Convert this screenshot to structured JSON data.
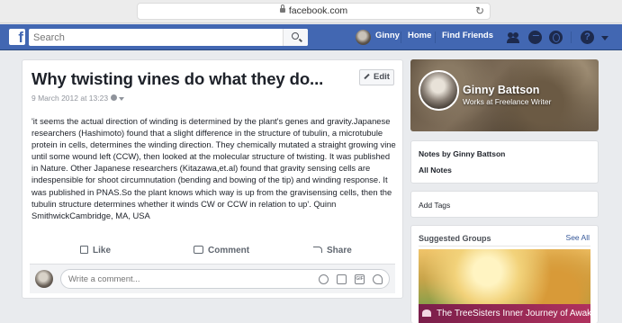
{
  "browser": {
    "url": "facebook.com"
  },
  "nav": {
    "logo": "f",
    "search_placeholder": "Search",
    "user": "Ginny",
    "home": "Home",
    "find_friends": "Find Friends",
    "help": "?"
  },
  "note": {
    "title": "Why twisting vines do what they do...",
    "edit_label": "Edit",
    "date": "9 March 2012 at 13:23",
    "body": "'it seems the actual direction of winding is determined by the plant's genes and gravity.Japanese researchers (Hashimoto) found that a slight difference in the structure of tubulin, a microtubule protein in cells, determines the winding direction. They chemically mutated a straight growing vine until some wound left (CCW), then looked at the molecular structure of twisting. It was published in Nature. Other Japanese researchers (Kitazawa,et.al) found that gravity sensing cells are indespensible for shoot circumnutation (bending and bowing of the tip) and winding response. It was published in PNAS.So the plant knows which way is up from the gravisensing cells, then the tubulin structure determines whether it winds CW or CCW in relation to up'. Quinn SmithwickCambridge, MA, USA",
    "actions": {
      "like": "Like",
      "comment": "Comment",
      "share": "Share"
    },
    "comment_placeholder": "Write a comment...",
    "gif_label": "GIF"
  },
  "profile": {
    "name": "Ginny Battson",
    "work": "Works at Freelance Writer"
  },
  "sidebar": {
    "notes_by": "Notes by Ginny Battson",
    "all_notes": "All Notes",
    "add_tags": "Add Tags",
    "suggested_groups": "Suggested Groups",
    "see_all": "See All",
    "group_name": "The TreeSisters Inner Journey of Awake"
  },
  "colors": {
    "fb_blue": "#4267b2",
    "link": "#365899",
    "text": "#1d2129",
    "muted": "#90949c"
  }
}
